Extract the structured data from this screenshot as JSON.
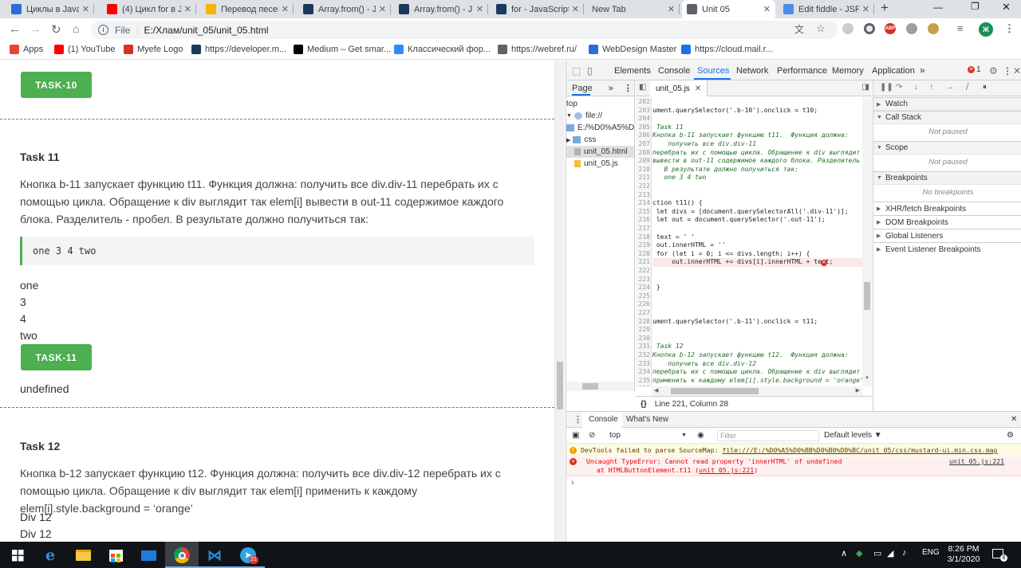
{
  "browser": {
    "tabs": [
      {
        "title": "Циклы в JavaScr",
        "icon": "shield-icon",
        "color": "#2d6bd8"
      },
      {
        "title": "(4) Цикл for в J",
        "icon": "youtube-icon",
        "color": "#ff0000"
      },
      {
        "title": "Перевод песен",
        "icon": "translate-icon",
        "color": "#f4b400"
      },
      {
        "title": "Array.from() - J",
        "icon": "mdn-icon",
        "color": "#1b3a5c"
      },
      {
        "title": "Array.from() - J",
        "icon": "mdn-icon",
        "color": "#1b3a5c"
      },
      {
        "title": "for - JavaScript",
        "icon": "mdn-icon",
        "color": "#1b3a5c"
      },
      {
        "title": "New Tab",
        "icon": "",
        "color": ""
      },
      {
        "title": "Unit 05",
        "icon": "globe-icon",
        "color": "#5f6368"
      },
      {
        "title": "Edit fiddle - JSF",
        "icon": "cloud-icon",
        "color": "#4a8fe7"
      }
    ],
    "url_scheme": "File",
    "url": "E:/Хлам/unit_05/unit_05.html",
    "bookmarks": [
      {
        "label": "Apps",
        "icon": "apps-icon"
      },
      {
        "label": "(1) YouTube",
        "icon": "youtube-icon"
      },
      {
        "label": "Myefe Logo",
        "icon": "myefe-icon"
      },
      {
        "label": "https://developer.m...",
        "icon": "mdn-icon"
      },
      {
        "label": "Medium – Get smar...",
        "icon": "medium-icon"
      },
      {
        "label": "Классический фор...",
        "icon": "bird-icon"
      },
      {
        "label": "https://webref.ru/",
        "icon": "page-icon"
      },
      {
        "label": "WebDesign Master",
        "icon": "globe-icon"
      },
      {
        "label": "https://cloud.mail.r...",
        "icon": "cloud-icon"
      }
    ],
    "avatar_letter": "Ж",
    "abp_label": "ABP"
  },
  "page": {
    "task10_button": "TASK-10",
    "task11_heading": "Task 11",
    "task11_text": "Кнопка b-11 запускает функцию t11. Функция должна: получить все div.div-11 перебрать их с помощью цикла. Обращение к div выглядит так elem[i] вывести в out-11 содержимое каждого блока. Разделитель - пробел. В результате должно получиться так:",
    "task11_code": "one 3 4 two",
    "task11_divs": [
      "one",
      "3",
      "4",
      "two"
    ],
    "task11_button": "TASK-11",
    "task11_output": "undefined",
    "task12_heading": "Task 12",
    "task12_text": "Кнопка b-12 запускает функцию t12. Функция должна: получить все div.div-12 перебрать их с помощью цикла. Обращение к div выглядит так elem[i] применить к каждому elem[i].style.background = ‘orange’",
    "task12_divs": [
      "Div 12",
      "Div 12"
    ]
  },
  "devtools": {
    "main_tabs": [
      "Elements",
      "Console",
      "Sources",
      "Network",
      "Performance",
      "Memory",
      "Application"
    ],
    "active_tab": "Sources",
    "more_tabs": "»",
    "error_count": "1",
    "navigator_tab": "Page",
    "tree": [
      {
        "label": "top",
        "icon": ""
      },
      {
        "label": "file://",
        "icon": "cloud-icon"
      },
      {
        "label": "E:/%D0%A5%D0%",
        "icon": "folder-icon"
      },
      {
        "label": "css",
        "icon": "folder-icon"
      },
      {
        "label": "unit_05.html",
        "icon": "file-icon"
      },
      {
        "label": "unit_05.js",
        "icon": "file-icon"
      }
    ],
    "file_tab": "unit_05.js",
    "code": [
      {
        "n": "202",
        "t": "",
        "c": false
      },
      {
        "n": "203",
        "t": "ument.querySelector('.b-10').onclick = t10;",
        "c": false
      },
      {
        "n": "204",
        "t": "",
        "c": false
      },
      {
        "n": "205",
        "t": " Task 11",
        "c": true
      },
      {
        "n": "206",
        "t": "Кнопка b-11 запускает функцию t11.  Функция должна:",
        "c": true
      },
      {
        "n": "207",
        "t": "    получить все div.div-11",
        "c": true
      },
      {
        "n": "208",
        "t": "перебрать их с помощью цикла. Обращение к div выглядит",
        "c": true
      },
      {
        "n": "209",
        "t": "вывести в out-11 содержимое каждого блока. Разделитель",
        "c": true
      },
      {
        "n": "210",
        "t": "   В результате должно получиться так:",
        "c": true
      },
      {
        "n": "211",
        "t": "   one 3 4 two",
        "c": true
      },
      {
        "n": "212",
        "t": "",
        "c": false
      },
      {
        "n": "213",
        "t": "",
        "c": false
      },
      {
        "n": "214",
        "t": "ction t11() {",
        "c": false
      },
      {
        "n": "215",
        "t": " let divs = [document.querySelectorAll('.div-11')];",
        "c": false
      },
      {
        "n": "216",
        "t": " let out = document.querySelector('.out-11');",
        "c": false
      },
      {
        "n": "217",
        "t": "",
        "c": false
      },
      {
        "n": "218",
        "t": " text = ' '",
        "c": false
      },
      {
        "n": "219",
        "t": " out.innerHTML = ''",
        "c": false
      },
      {
        "n": "220",
        "t": " for (let i = 0; i <= divs.length; i++) {",
        "c": false
      },
      {
        "n": "221",
        "t": "     out.innerHTML += divs[i].innerHTML + text;",
        "c": false
      },
      {
        "n": "222",
        "t": "",
        "c": false
      },
      {
        "n": "223",
        "t": "",
        "c": false
      },
      {
        "n": "224",
        "t": " }",
        "c": false
      },
      {
        "n": "225",
        "t": "",
        "c": false
      },
      {
        "n": "226",
        "t": "",
        "c": false
      },
      {
        "n": "227",
        "t": "",
        "c": false
      },
      {
        "n": "228",
        "t": "ument.querySelector('.b-11').onclick = t11;",
        "c": false
      },
      {
        "n": "229",
        "t": "",
        "c": false
      },
      {
        "n": "230",
        "t": "",
        "c": false
      },
      {
        "n": "231",
        "t": " Task 12",
        "c": true
      },
      {
        "n": "232",
        "t": "Кнопка b-12 запускает функцию t12.  Функция должна:",
        "c": true
      },
      {
        "n": "233",
        "t": "    получить все div.div-12",
        "c": true
      },
      {
        "n": "234",
        "t": "перебрать их с помощью цикла. Обращение к div выглядит",
        "c": true
      },
      {
        "n": "235",
        "t": "применить к каждому elem[i].style.background = 'orange'",
        "c": true
      },
      {
        "n": "236",
        "t": "",
        "c": false
      }
    ],
    "error_line": "221",
    "status": "Line 221, Column 28",
    "debugger_sections": [
      {
        "label": "Watch",
        "open": false,
        "empty": ""
      },
      {
        "label": "Call Stack",
        "open": true,
        "empty": "Not paused"
      },
      {
        "label": "Scope",
        "open": true,
        "empty": "Not paused"
      },
      {
        "label": "Breakpoints",
        "open": true,
        "empty": "No breakpoints"
      },
      {
        "label": "XHR/fetch Breakpoints",
        "open": false,
        "empty": ""
      },
      {
        "label": "DOM Breakpoints",
        "open": false,
        "empty": ""
      },
      {
        "label": "Global Listeners",
        "open": false,
        "empty": ""
      },
      {
        "label": "Event Listener Breakpoints",
        "open": false,
        "empty": ""
      }
    ],
    "drawer_tabs": [
      "Console",
      "What's New"
    ],
    "context": "top",
    "filter_placeholder": "Filter",
    "levels": "Default levels ▼",
    "warning": {
      "text": "DevTools failed to parse SourceMap: ",
      "link": "file:///E:/%D0%A5%D0%BB%D0%B0%D0%BC/unit_05/css/mustard-ui.min.css.map"
    },
    "error": {
      "text": "Uncaught TypeError: Cannot read property 'innerHTML' of undefined",
      "trace": "at HTMLButtonElement.t11 (",
      "trace_link": "unit_05.js:221",
      "trace_end": ")",
      "source": "unit_05.js:221"
    },
    "prompt": "›"
  },
  "taskbar": {
    "lang": "ENG",
    "time": "8:26 PM",
    "date": "3/1/2020",
    "telegram_badge": "21",
    "notify_count": "8"
  }
}
